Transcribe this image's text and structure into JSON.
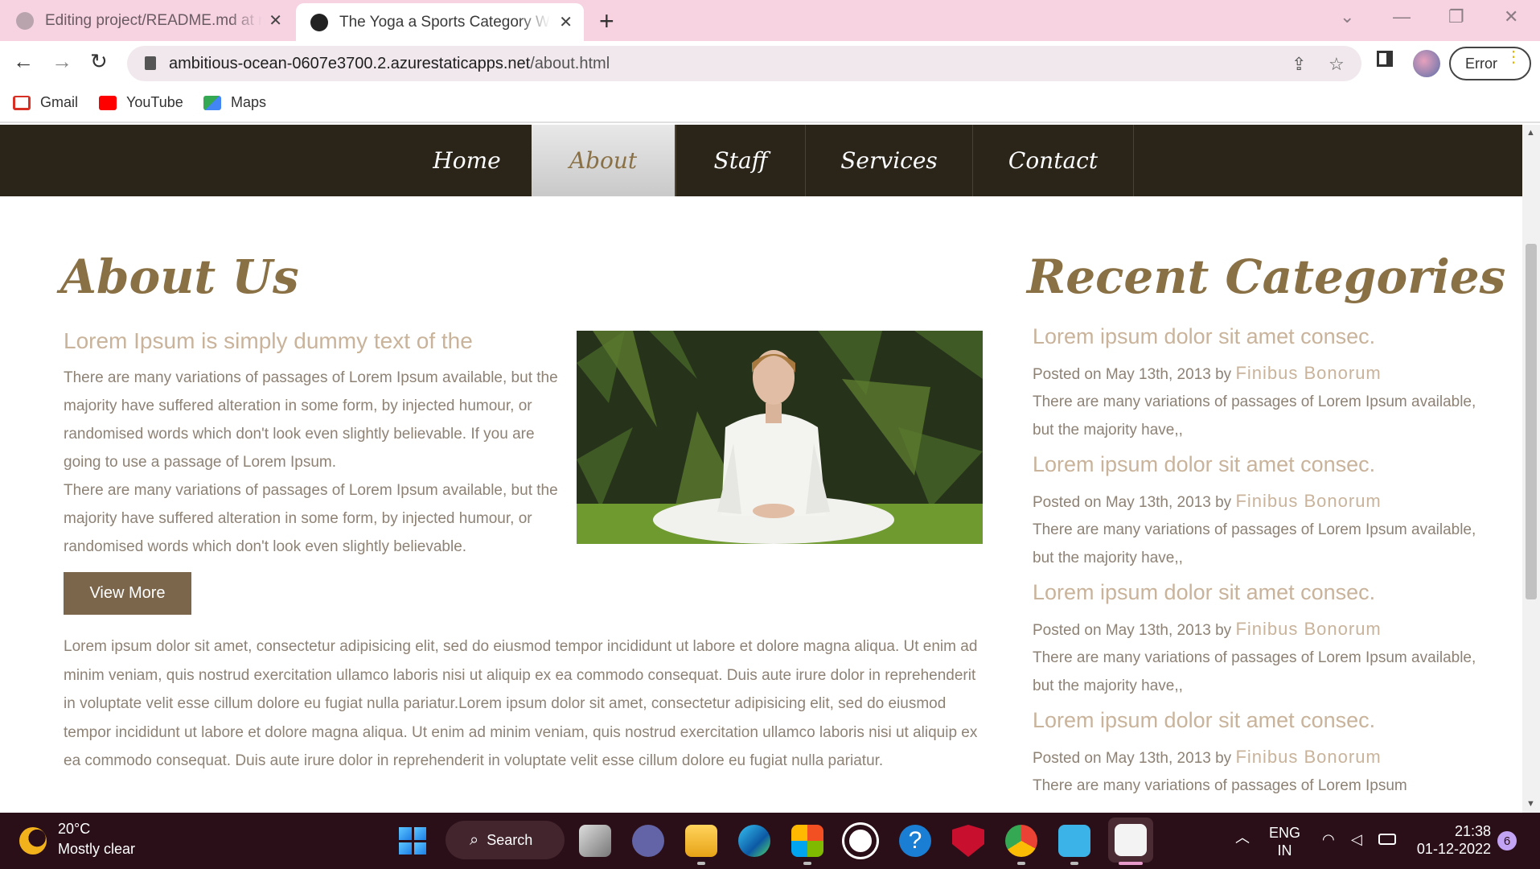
{
  "browser": {
    "tabs": [
      {
        "title": "Editing project/README.md at m",
        "close": "✕"
      },
      {
        "title": "The Yoga a Sports Category Web",
        "close": "✕"
      }
    ],
    "new_tab": "+",
    "window_controls": {
      "minimize": "—",
      "maximize": "❐",
      "close": "✕",
      "tab_search": "⌄"
    },
    "nav": {
      "back": "←",
      "forward": "→",
      "reload": "↻"
    },
    "url_host": "ambitious-ocean-0607e3700.2.azurestaticapps.net",
    "url_path": "/about.html",
    "error_label": "Error",
    "bookmarks": [
      {
        "label": "Gmail",
        "color": "#d93025"
      },
      {
        "label": "YouTube",
        "color": "#ff0000"
      },
      {
        "label": "Maps",
        "color": "#34a853"
      }
    ]
  },
  "site": {
    "nav": [
      "Home",
      "About",
      "Staff",
      "Services",
      "Contact"
    ],
    "active_nav": "About",
    "about_title": "About Us",
    "subheading": "Lorem Ipsum is simply dummy text of the",
    "paragraph1": "There are many variations of passages of Lorem Ipsum available, but the majority have suffered alteration in some form, by injected humour, or randomised words which don't look even slightly believable. If you are going to use a passage of Lorem Ipsum.",
    "paragraph2": "There are many variations of passages of Lorem Ipsum available, but the majority have suffered alteration in some form, by injected humour, or randomised words which don't look even slightly believable.",
    "view_more": "View More",
    "lorem": "Lorem ipsum dolor sit amet, consectetur adipisicing elit, sed do eiusmod tempor incididunt ut labore et dolore magna aliqua. Ut enim ad minim veniam, quis nostrud exercitation ullamco laboris nisi ut aliquip ex ea commodo consequat. Duis aute irure dolor in reprehenderit in voluptate velit esse cillum dolore eu fugiat nulla pariatur.Lorem ipsum dolor sit amet, consectetur adipisicing elit, sed do eiusmod tempor incididunt ut labore et dolore magna aliqua. Ut enim ad minim veniam, quis nostrud exercitation ullamco laboris nisi ut aliquip ex ea commodo consequat. Duis aute irure dolor in reprehenderit in voluptate velit esse cillum dolore eu fugiat nulla pariatur.",
    "recent_title": "Recent Categories",
    "categories": [
      {
        "title": "Lorem ipsum dolor sit amet consec.",
        "posted": "Posted on May 13th, 2013 by ",
        "author": "Finibus Bonorum",
        "excerpt": "There are many variations of passages of Lorem Ipsum available, but the majority have,,"
      },
      {
        "title": "Lorem ipsum dolor sit amet consec.",
        "posted": "Posted on May 13th, 2013 by ",
        "author": "Finibus Bonorum",
        "excerpt": "There are many variations of passages of Lorem Ipsum available, but the majority have,,"
      },
      {
        "title": "Lorem ipsum dolor sit amet consec.",
        "posted": "Posted on May 13th, 2013 by ",
        "author": "Finibus Bonorum",
        "excerpt": "There are many variations of passages of Lorem Ipsum available, but the majority have,,"
      },
      {
        "title": "Lorem ipsum dolor sit amet consec.",
        "posted": "Posted on May 13th, 2013 by ",
        "author": "Finibus Bonorum",
        "excerpt": "There are many variations of passages of Lorem Ipsum"
      }
    ]
  },
  "taskbar": {
    "temperature": "20°C",
    "condition": "Mostly clear",
    "search_label": "Search",
    "language": "ENG",
    "region": "IN",
    "time": "21:38",
    "date": "01-12-2022",
    "notifications": "6"
  },
  "colors": {
    "nav_bg": "#2a2419",
    "accent": "#8a7045",
    "muted_heading": "#c9b39b",
    "body_text": "#8e8275",
    "button_bg": "#7b664b",
    "tabstrip": "#f7d3e2",
    "taskbar": "#2b0f18"
  }
}
